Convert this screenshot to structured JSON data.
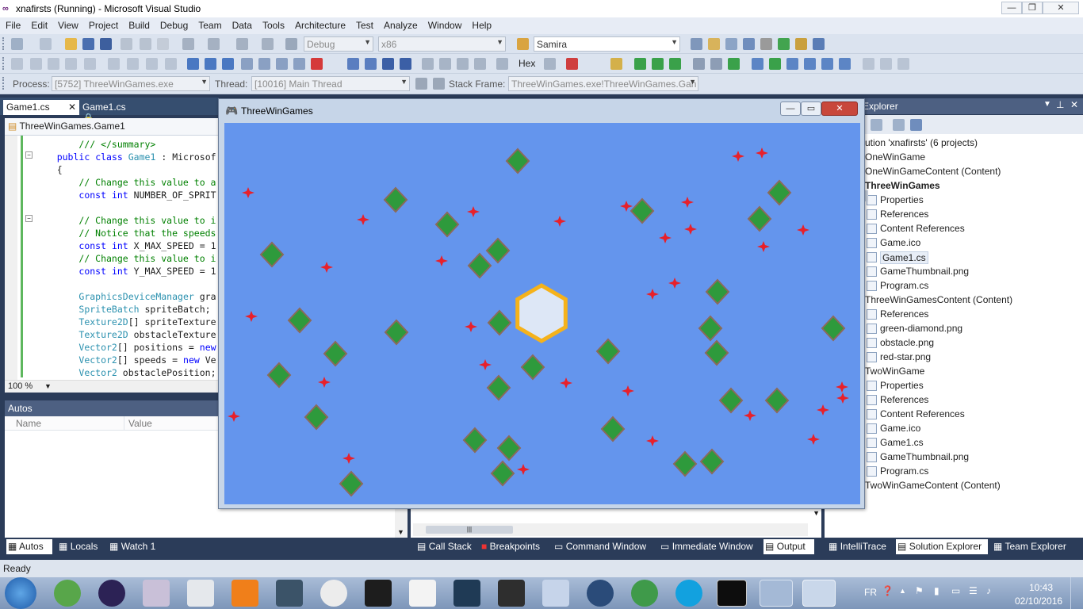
{
  "window": {
    "title": "xnafirsts (Running) - Microsoft Visual Studio"
  },
  "menu": [
    "File",
    "Edit",
    "View",
    "Project",
    "Build",
    "Debug",
    "Team",
    "Data",
    "Tools",
    "Architecture",
    "Test",
    "Analyze",
    "Window",
    "Help"
  ],
  "toolbar": {
    "config": "Debug",
    "platform": "x86",
    "search": "Samira",
    "hex_label": "Hex"
  },
  "debugbar": {
    "process_label": "Process:",
    "process": "[5752] ThreeWinGames.exe",
    "thread_label": "Thread:",
    "thread": "[10016] Main Thread",
    "stack_label": "Stack Frame:",
    "stack": "ThreeWinGames.exe!ThreeWinGames.Gan"
  },
  "editor": {
    "tabs": [
      "Game1.cs",
      "Game1.cs"
    ],
    "navbar": "ThreeWinGames.Game1",
    "zoom": "100 %",
    "lines": [
      {
        "t": "        /// </summary>",
        "c": "cm"
      },
      {
        "t": "    public class Game1 : Microsof",
        "c": "mix1"
      },
      {
        "t": "    {",
        "c": ""
      },
      {
        "t": "        // Change this value to a",
        "c": "cm"
      },
      {
        "t": "        const int NUMBER_OF_SPRIT",
        "c": "mix2"
      },
      {
        "t": "",
        "c": ""
      },
      {
        "t": "        // Change this value to i",
        "c": "cm"
      },
      {
        "t": "        // Notice that the speeds",
        "c": "cm"
      },
      {
        "t": "        const int X_MAX_SPEED = 1",
        "c": "mix2"
      },
      {
        "t": "        // Change this value to i",
        "c": "cm"
      },
      {
        "t": "        const int Y_MAX_SPEED = 1",
        "c": "mix2"
      },
      {
        "t": "",
        "c": ""
      },
      {
        "t": "        GraphicsDeviceManager gra",
        "c": "mix3"
      },
      {
        "t": "        SpriteBatch spriteBatch;",
        "c": "mix3"
      },
      {
        "t": "        Texture2D[] spriteTexture",
        "c": "mix3"
      },
      {
        "t": "        Texture2D obstacleTexture",
        "c": "mix3"
      },
      {
        "t": "        Vector2[] positions = new",
        "c": "mix4"
      },
      {
        "t": "        Vector2[] speeds = new Ve",
        "c": "mix4"
      },
      {
        "t": "        Vector2 obstaclePosition;",
        "c": "mix3"
      }
    ]
  },
  "autos": {
    "title": "Autos",
    "col_name": "Name",
    "col_value": "Value"
  },
  "bottom_tabs_left": [
    "Autos",
    "Locals",
    "Watch 1"
  ],
  "bottom_tabs_mid": [
    "Call Stack",
    "Breakpoints",
    "Command Window",
    "Immediate Window",
    "Output"
  ],
  "bottom_tabs_right": [
    "IntelliTrace",
    "Solution Explorer",
    "Team Explorer"
  ],
  "solution_explorer": {
    "title": "Explorer",
    "items": [
      {
        "text": "ution 'xnafirsts' (6 projects)",
        "bold": false,
        "indent": 0
      },
      {
        "text": "OneWinGame",
        "bold": false,
        "indent": 0
      },
      {
        "text": "OneWinGameContent (Content)",
        "bold": false,
        "indent": 0
      },
      {
        "text": "ThreeWinGames",
        "bold": true,
        "indent": 0
      },
      {
        "text": "Properties",
        "bold": false,
        "indent": 1
      },
      {
        "text": "References",
        "bold": false,
        "indent": 1
      },
      {
        "text": "Content References",
        "bold": false,
        "indent": 1
      },
      {
        "text": "Game.ico",
        "bold": false,
        "indent": 1
      },
      {
        "text": "Game1.cs",
        "bold": false,
        "indent": 1,
        "selected": true
      },
      {
        "text": "GameThumbnail.png",
        "bold": false,
        "indent": 1
      },
      {
        "text": "Program.cs",
        "bold": false,
        "indent": 1
      },
      {
        "text": "ThreeWinGamesContent (Content)",
        "bold": false,
        "indent": 0
      },
      {
        "text": "References",
        "bold": false,
        "indent": 1
      },
      {
        "text": "green-diamond.png",
        "bold": false,
        "indent": 1
      },
      {
        "text": "obstacle.png",
        "bold": false,
        "indent": 1
      },
      {
        "text": "red-star.png",
        "bold": false,
        "indent": 1
      },
      {
        "text": "TwoWinGame",
        "bold": false,
        "indent": 0
      },
      {
        "text": "Properties",
        "bold": false,
        "indent": 1
      },
      {
        "text": "References",
        "bold": false,
        "indent": 1
      },
      {
        "text": "Content References",
        "bold": false,
        "indent": 1
      },
      {
        "text": "Game.ico",
        "bold": false,
        "indent": 1
      },
      {
        "text": "Game1.cs",
        "bold": false,
        "indent": 1
      },
      {
        "text": "GameThumbnail.png",
        "bold": false,
        "indent": 1
      },
      {
        "text": "Program.cs",
        "bold": false,
        "indent": 1
      },
      {
        "text": "TwoWinGameContent (Content)",
        "bold": false,
        "indent": 0
      }
    ]
  },
  "game_window": {
    "title": "ThreeWinGames"
  },
  "status": {
    "text": "Ready"
  },
  "tray": {
    "lang": "FR",
    "time": "10:43",
    "date": "02/10/2016"
  },
  "colors": {
    "game_bg": "#6495ed",
    "diamond": "#2e9a3c",
    "star": "#e8202a",
    "obstacle": "#f5b21b"
  }
}
